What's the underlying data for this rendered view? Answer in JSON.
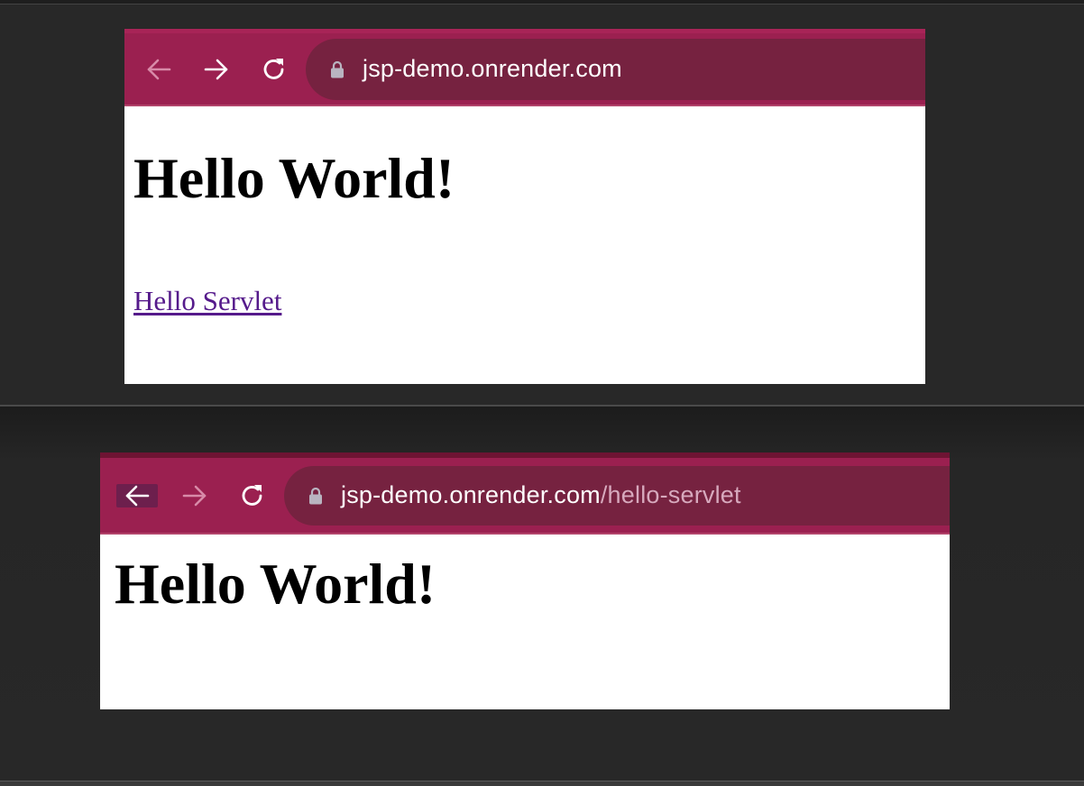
{
  "window_1": {
    "url_host": "jsp-demo.onrender.com",
    "url_path": "",
    "back_enabled": false,
    "forward_enabled": true,
    "heading": "Hello World!",
    "link_text": "Hello Servlet"
  },
  "window_2": {
    "url_host": "jsp-demo.onrender.com",
    "url_path": "/hello-servlet",
    "back_enabled": true,
    "forward_enabled": false,
    "heading": "Hello World!"
  },
  "icons": {
    "back": "arrow-left-icon",
    "forward": "arrow-right-icon",
    "reload": "reload-icon",
    "lock": "lock-icon"
  },
  "colors": {
    "toolbar": "#9b2050",
    "address_bar": "#762240",
    "link_visited": "#551a8b",
    "background": "#282828"
  }
}
